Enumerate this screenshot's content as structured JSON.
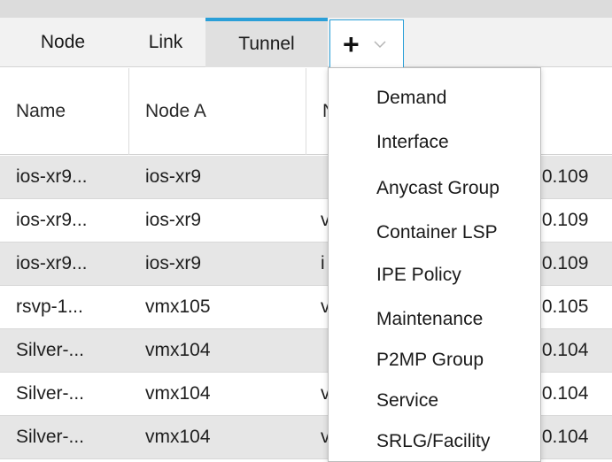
{
  "tabs": [
    "Node",
    "Link",
    "Tunnel"
  ],
  "add_tab": {
    "icon": "plus-icon",
    "chevron": "chevron-down-icon"
  },
  "columns": {
    "name": "Name",
    "node_a": "Node A",
    "node_z": "N"
  },
  "rows": [
    {
      "name": "ios-xr9...",
      "node_a": "ios-xr9",
      "node_z": "",
      "ip": ".0.109"
    },
    {
      "name": "ios-xr9...",
      "node_a": "ios-xr9",
      "node_z": "v",
      "ip": ".0.109"
    },
    {
      "name": "ios-xr9...",
      "node_a": "ios-xr9",
      "node_z": "i",
      "ip": ".0.109"
    },
    {
      "name": "rsvp-1...",
      "node_a": "vmx105",
      "node_z": "v",
      "ip": ".0.105"
    },
    {
      "name": "Silver-...",
      "node_a": "vmx104",
      "node_z": "",
      "ip": ".0.104"
    },
    {
      "name": "Silver-...",
      "node_a": "vmx104",
      "node_z": "v",
      "ip": ".0.104"
    },
    {
      "name": "Silver-...",
      "node_a": "vmx104",
      "node_z": "v",
      "ip": ".0.104"
    }
  ],
  "menu": [
    "Demand",
    "Interface",
    "Anycast Group",
    "Container LSP",
    "IPE Policy",
    "Maintenance",
    "P2MP Group",
    "Service",
    "SRLG/Facility"
  ],
  "colors": {
    "accent": "#2a9fd8",
    "row_shade": "#e6e6e6",
    "tab_bar": "#f2f2f2"
  }
}
